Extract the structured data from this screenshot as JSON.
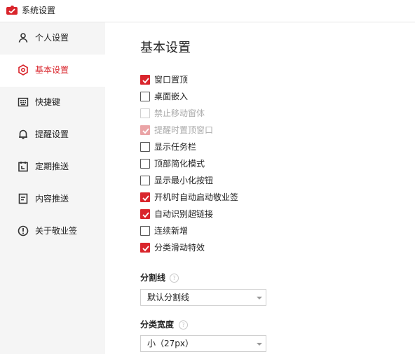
{
  "window": {
    "title": "系统设置",
    "logo_icon": "app-logo-icon",
    "accent_color": "#d9252c"
  },
  "sidebar": {
    "items": [
      {
        "label": "个人设置",
        "icon": "person-icon",
        "active": false
      },
      {
        "label": "基本设置",
        "icon": "settings-circle-icon",
        "active": true
      },
      {
        "label": "快捷键",
        "icon": "keyboard-icon",
        "active": false
      },
      {
        "label": "提醒设置",
        "icon": "bell-icon",
        "active": false
      },
      {
        "label": "定期推送",
        "icon": "calendar-icon",
        "active": false
      },
      {
        "label": "内容推送",
        "icon": "document-icon",
        "active": false
      },
      {
        "label": "关于敬业签",
        "icon": "info-icon",
        "active": false
      }
    ]
  },
  "main": {
    "title": "基本设置",
    "options": [
      {
        "label": "窗口置顶",
        "checked": true,
        "disabled": false
      },
      {
        "label": "桌面嵌入",
        "checked": false,
        "disabled": false
      },
      {
        "label": "禁止移动窗体",
        "checked": false,
        "disabled": true
      },
      {
        "label": "提醒时置顶窗口",
        "checked": true,
        "disabled": true
      },
      {
        "label": "显示任务栏",
        "checked": false,
        "disabled": false
      },
      {
        "label": "顶部简化模式",
        "checked": false,
        "disabled": false
      },
      {
        "label": "显示最小化按钮",
        "checked": false,
        "disabled": false
      },
      {
        "label": "开机时自动启动敬业签",
        "checked": true,
        "disabled": false
      },
      {
        "label": "自动识别超链接",
        "checked": true,
        "disabled": false
      },
      {
        "label": "连续新增",
        "checked": false,
        "disabled": false
      },
      {
        "label": "分类滑动特效",
        "checked": true,
        "disabled": false
      }
    ],
    "divider_field": {
      "label": "分割线",
      "help": "?",
      "value": "默认分割线"
    },
    "width_field": {
      "label": "分类宽度",
      "help": "?",
      "value": "小（27px）"
    }
  }
}
